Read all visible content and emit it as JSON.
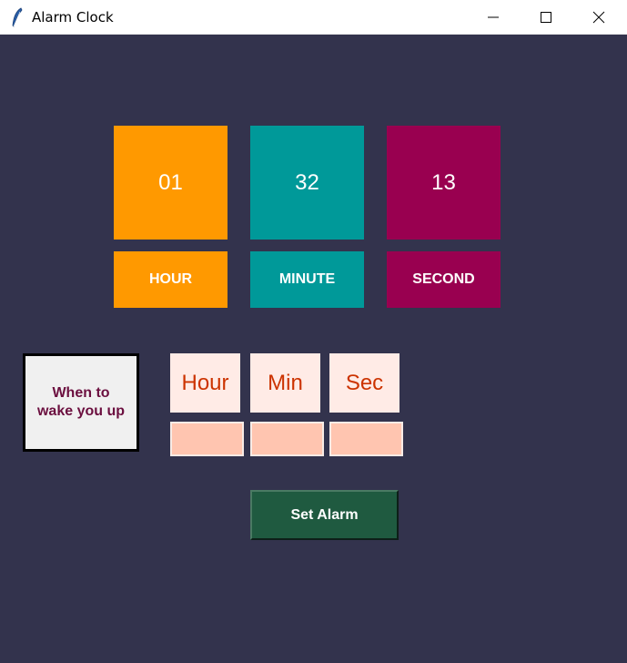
{
  "window": {
    "title": "Alarm Clock",
    "icon": "feather-icon"
  },
  "clock": {
    "hour": "01",
    "minute": "32",
    "second": "13",
    "hour_label": "HOUR",
    "minute_label": "MINUTE",
    "second_label": "SECOND"
  },
  "alarm": {
    "prompt_line1": "When to",
    "prompt_line2": "wake you up",
    "hour_label": "Hour",
    "minute_label": "Min",
    "second_label": "Sec",
    "hour_value": "",
    "minute_value": "",
    "second_value": "",
    "set_button": "Set Alarm"
  },
  "colors": {
    "background": "#33334d",
    "hour_tile": "#ff9900",
    "minute_tile": "#009999",
    "second_tile": "#990050",
    "label_box": "#ffebe6",
    "entry_bg": "#ffc5b0",
    "button": "#1f5a40"
  }
}
